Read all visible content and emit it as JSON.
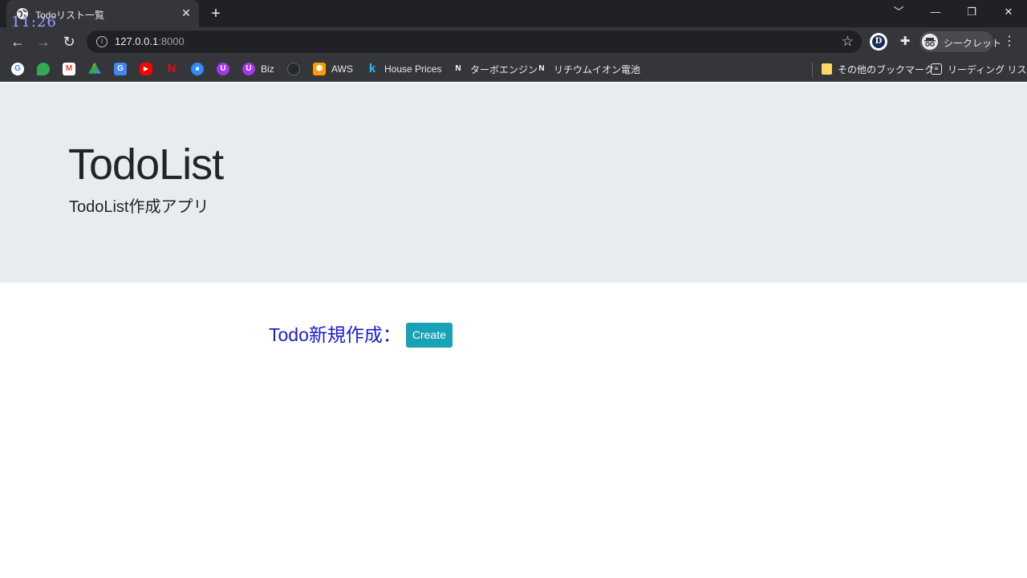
{
  "browser": {
    "tab_title": "Todoリスト一覧",
    "clock_overlay": "11:26",
    "tab_close": "✕",
    "new_tab": "+",
    "url_host": "127.0.0.1",
    "url_port": ":8000",
    "incognito_label": "シークレット",
    "profile_letter": "D",
    "window_controls": [
      "﹀",
      "—",
      "❐",
      "✕"
    ]
  },
  "bookmarks": {
    "items": [
      {
        "label": "",
        "icon": "google-icon",
        "color": "#4285f4"
      },
      {
        "label": "",
        "icon": "maps-icon",
        "color": "#34a853"
      },
      {
        "label": "",
        "icon": "gmail-icon",
        "color": "#ea4335"
      },
      {
        "label": "",
        "icon": "drive-icon",
        "color": "#fbbc04"
      },
      {
        "label": "",
        "icon": "translate-icon",
        "color": "#4285f4"
      },
      {
        "label": "",
        "icon": "youtube-icon",
        "color": "#ff0000"
      },
      {
        "label": "",
        "icon": "netflix-icon",
        "color": "#e50914"
      },
      {
        "label": "",
        "icon": "zoom-icon",
        "color": "#2d8cff"
      },
      {
        "label": "",
        "icon": "udemy-icon",
        "color": "#a435f0"
      },
      {
        "label": "Biz",
        "icon": "udemy-biz-icon",
        "color": "#a435f0"
      },
      {
        "label": "",
        "icon": "github-icon",
        "color": "#24292e"
      },
      {
        "label": "AWS",
        "icon": "aws-icon",
        "color": "#ff9900"
      },
      {
        "label": "House Prices",
        "icon": "kaggle-icon",
        "color": "#20beff"
      },
      {
        "label": "ターボエンジン",
        "icon": "note-icon",
        "color": "#ffffff"
      },
      {
        "label": "リチウムイオン電池",
        "icon": "note-icon",
        "color": "#ffffff"
      }
    ],
    "other_bookmarks": "その他のブックマーク",
    "reading_list": "リーディング リスト"
  },
  "page": {
    "title": "TodoList",
    "lead": "TodoList作成アプリ",
    "create_label": "Todo新規作成：",
    "create_button": "Create",
    "accent_color": "#17a2b8",
    "label_color": "#1b1bcc"
  }
}
